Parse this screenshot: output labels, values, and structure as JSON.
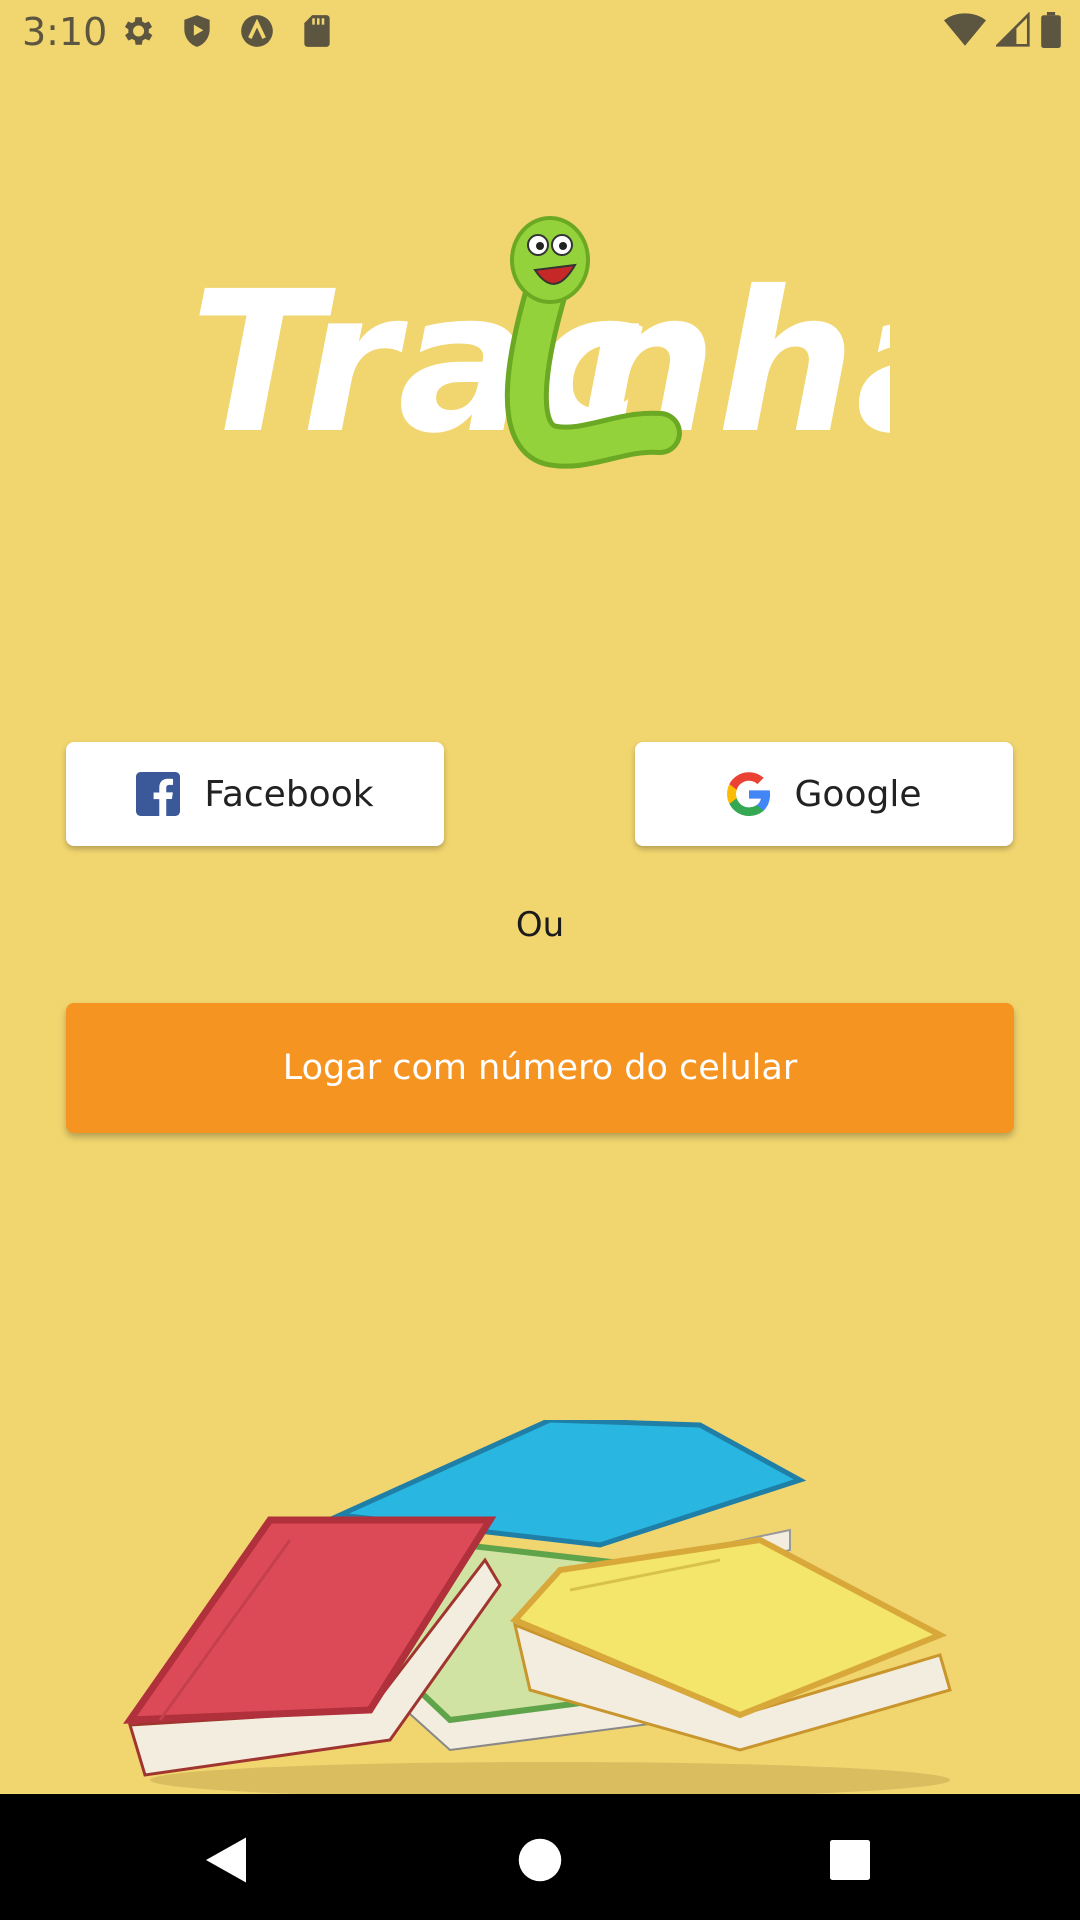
{
  "status_bar": {
    "time": "3:10",
    "left_icons": [
      "settings-icon",
      "shield-play-icon",
      "a-circle-icon",
      "sd-card-icon"
    ],
    "right_icons": [
      "wifi-icon",
      "signal-icon",
      "battery-icon"
    ]
  },
  "logo": {
    "text": "Tracinha",
    "mascot": "green-worm"
  },
  "login": {
    "facebook_label": "Facebook",
    "google_label": "Google",
    "or_label": "Ou",
    "phone_label": "Logar com número do celular"
  },
  "illustration": {
    "name": "books-stack"
  },
  "nav_bar": {
    "icons": [
      "back-icon",
      "home-icon",
      "recents-icon"
    ]
  },
  "colors": {
    "background": "#F1D56F",
    "primary_button": "#F69422",
    "facebook_blue": "#3B5998"
  }
}
